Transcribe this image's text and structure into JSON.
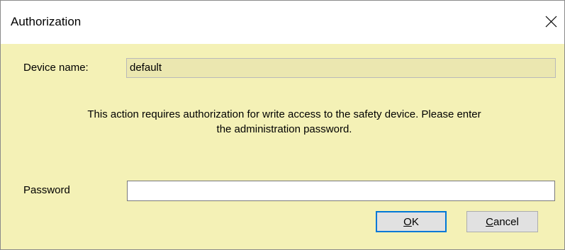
{
  "window": {
    "title": "Authorization",
    "close_glyph": "✕"
  },
  "device": {
    "label": "Device name:",
    "value": "default"
  },
  "message": {
    "line1": "This action requires authorization for write access to the safety device. Please enter",
    "line2": "the administration password."
  },
  "password": {
    "label": "Password",
    "value": ""
  },
  "buttons": {
    "ok_mnemonic": "O",
    "ok_rest": "K",
    "cancel_mnemonic": "C",
    "cancel_rest": "ancel"
  },
  "colors": {
    "content_background": "#f4f1b6",
    "accent": "#0078d7"
  }
}
